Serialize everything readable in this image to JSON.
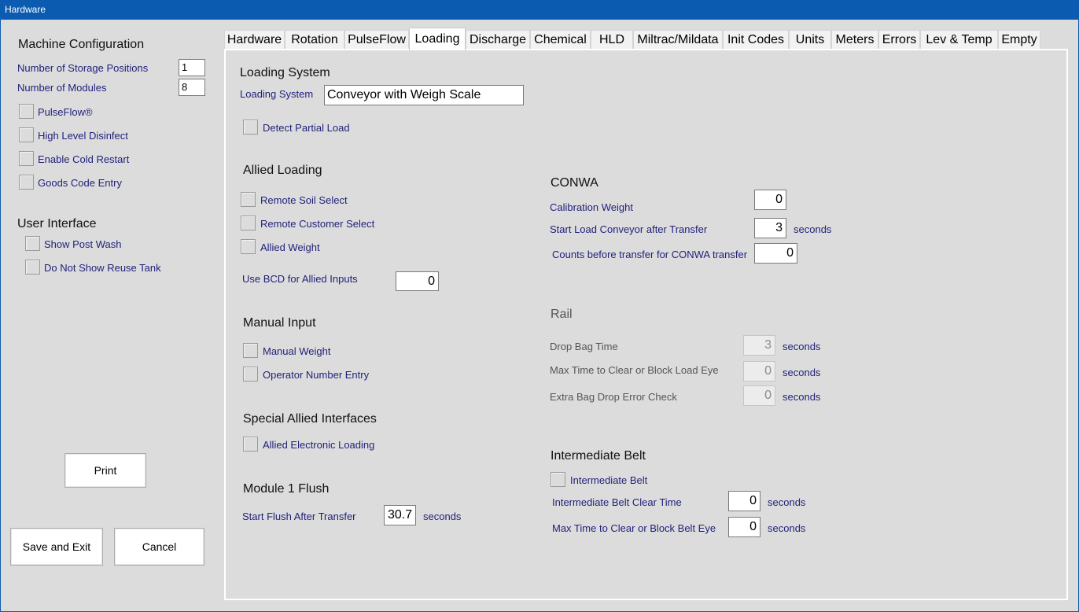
{
  "window": {
    "title": "Hardware"
  },
  "left": {
    "machine_config": {
      "header": "Machine Configuration",
      "storage_label": "Number of Storage Positions",
      "storage_value": "1",
      "modules_label": "Number of Modules",
      "modules_value": "8",
      "checkboxes": [
        "PulseFlow®",
        "High Level Disinfect",
        "Enable Cold Restart",
        "Goods Code Entry"
      ]
    },
    "user_interface": {
      "header": "User Interface",
      "checkboxes": [
        "Show Post Wash",
        "Do Not Show Reuse Tank"
      ]
    },
    "buttons": {
      "print": "Print",
      "save_exit": "Save and Exit",
      "cancel": "Cancel"
    }
  },
  "tabs": [
    "Hardware",
    "Rotation",
    "PulseFlow",
    "Loading",
    "Discharge",
    "Chemical",
    "HLD",
    "Miltrac/Mildata",
    "Init Codes",
    "Units",
    "Meters",
    "Errors",
    "Lev & Temp",
    "Empty"
  ],
  "active_tab": "Loading",
  "loading": {
    "loading_system": {
      "header": "Loading System",
      "label": "Loading System",
      "value": "Conveyor with Weigh Scale",
      "detect_partial": "Detect Partial Load"
    },
    "allied_loading": {
      "header": "Allied Loading",
      "remote_soil": "Remote Soil Select",
      "remote_customer": "Remote Customer Select",
      "allied_weight": "Allied Weight",
      "bcd_label": "Use BCD for Allied Inputs",
      "bcd_value": "0"
    },
    "manual_input": {
      "header": "Manual Input",
      "manual_weight": "Manual Weight",
      "operator_number": "Operator Number Entry"
    },
    "special_allied": {
      "header": "Special Allied Interfaces",
      "allied_electronic": "Allied Electronic Loading"
    },
    "module1_flush": {
      "header": "Module 1 Flush",
      "label": "Start Flush After Transfer",
      "value": "30.7",
      "unit": "seconds"
    },
    "conwa": {
      "header": "CONWA",
      "calibration_label": "Calibration Weight",
      "calibration_value": "0",
      "start_conveyor_label": "Start Load Conveyor after Transfer",
      "start_conveyor_value": "3",
      "start_conveyor_unit": "seconds",
      "counts_label": "Counts before transfer for CONWA transfer",
      "counts_value": "0"
    },
    "rail": {
      "header": "Rail",
      "drop_bag_label": "Drop Bag Time",
      "drop_bag_value": "3",
      "drop_bag_unit": "seconds",
      "max_clear_label": "Max Time to Clear or Block Load Eye",
      "max_clear_value": "0",
      "max_clear_unit": "seconds",
      "extra_bag_label": "Extra Bag Drop Error Check",
      "extra_bag_value": "0",
      "extra_bag_unit": "seconds"
    },
    "intermediate_belt": {
      "header": "Intermediate Belt",
      "checkbox": "Intermediate Belt",
      "clear_label": "Intermediate Belt Clear Time",
      "clear_value": "0",
      "clear_unit": "seconds",
      "max_label": "Max Time to Clear or Block Belt Eye",
      "max_value": "0",
      "max_unit": "seconds"
    }
  }
}
